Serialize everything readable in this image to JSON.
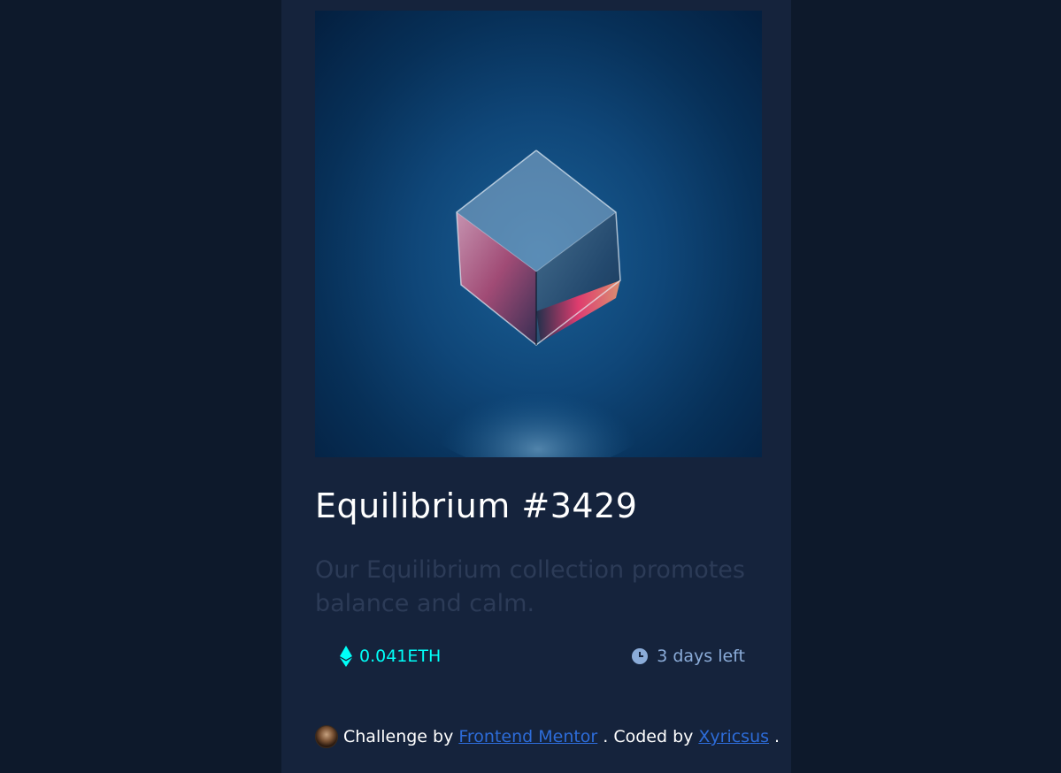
{
  "card": {
    "image_alt": "Equilibrium cube",
    "title": "Equilibrium #3429",
    "description": "Our Equilibrium collection promotes balance and calm.",
    "price": "0.041ETH",
    "price_icon": "ethereum-icon",
    "time_left": "3 days left",
    "time_icon": "clock-icon"
  },
  "footer": {
    "prefix": "Challenge by",
    "challenge_link": "Frontend Mentor",
    "middle": ". Coded by",
    "author_link": "Xyricsus",
    "suffix": "."
  },
  "colors": {
    "page_bg": "#0d192b",
    "card_bg": "#15233c",
    "accent_cyan": "#00fff8",
    "soft_blue": "#8bacd9",
    "link_blue": "#2d6cd9"
  }
}
